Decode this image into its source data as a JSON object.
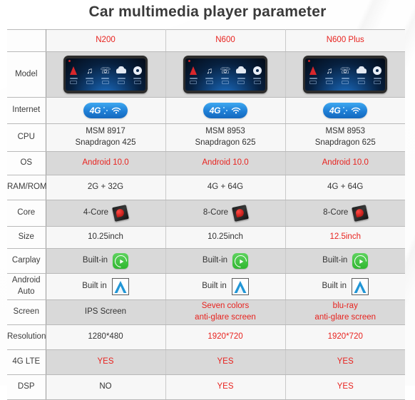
{
  "page": {
    "title": "Car multimedia player parameter",
    "accent_red": "#e8231f",
    "text_dark": "#333333",
    "row_shade": "#d9d9d9",
    "row_plain": "#f7f7f7"
  },
  "table": {
    "spec_column_header": "",
    "columns": [
      "N200",
      "N600",
      "N600 Plus"
    ],
    "rows": [
      {
        "label": "Model",
        "type": "image",
        "icon": "car-head-unit",
        "values": [
          "",
          "",
          ""
        ],
        "headunit_icons": [
          "navigation-icon",
          "music-note-icon",
          "phone-icon",
          "car-icon",
          "settings-gear-icon"
        ]
      },
      {
        "label": "Internet",
        "type": "badge",
        "icon": "4g-wifi-badge",
        "badge_text": "4G",
        "values": [
          "",
          "",
          ""
        ]
      },
      {
        "label": "CPU",
        "type": "text2",
        "values": [
          [
            "MSM 8917",
            "Snapdragon 425"
          ],
          [
            "MSM 8953",
            "Snapdragon 625"
          ],
          [
            "MSM 8953",
            "Snapdragon 625"
          ]
        ],
        "red": [
          false,
          false,
          false
        ]
      },
      {
        "label": "OS",
        "type": "text",
        "values": [
          "Android 10.0",
          "Android 10.0",
          "Android 10.0"
        ],
        "red": [
          true,
          true,
          true
        ]
      },
      {
        "label": "RAM/ROM",
        "type": "text",
        "values": [
          "2G + 32G",
          "4G + 64G",
          "4G + 64G"
        ],
        "red": [
          false,
          false,
          false
        ]
      },
      {
        "label": "Core",
        "type": "text-chip",
        "icon": "snapdragon-chip-icon",
        "values": [
          "4-Core",
          "8-Core",
          "8-Core"
        ],
        "red": [
          false,
          false,
          false
        ]
      },
      {
        "label": "Size",
        "type": "text",
        "values": [
          "10.25inch",
          "10.25inch",
          "12.5inch"
        ],
        "red": [
          false,
          false,
          true
        ]
      },
      {
        "label": "Carplay",
        "type": "text-icon",
        "icon": "carplay-icon",
        "values": [
          "Built-in",
          "Built-in",
          "Built-in"
        ],
        "red": [
          false,
          false,
          false
        ]
      },
      {
        "label": "Android Auto",
        "label_lines": [
          "Android",
          "Auto"
        ],
        "type": "text-icon",
        "icon": "android-auto-icon",
        "values": [
          "Built in",
          "Built in",
          "Built in"
        ],
        "red": [
          false,
          false,
          false
        ]
      },
      {
        "label": "Screen",
        "type": "text2",
        "values": [
          [
            "IPS Screen",
            ""
          ],
          [
            "Seven colors",
            "anti-glare screen"
          ],
          [
            "blu-ray",
            "anti-glare screen"
          ]
        ],
        "red": [
          false,
          true,
          true
        ]
      },
      {
        "label": "Resolution",
        "type": "text",
        "values": [
          "1280*480",
          "1920*720",
          "1920*720"
        ],
        "red": [
          false,
          true,
          true
        ]
      },
      {
        "label": "4G LTE",
        "type": "text",
        "values": [
          "YES",
          "YES",
          "YES"
        ],
        "red": [
          true,
          true,
          true
        ]
      },
      {
        "label": "DSP",
        "type": "text",
        "values": [
          "NO",
          "YES",
          "YES"
        ],
        "red": [
          false,
          true,
          true
        ]
      }
    ]
  }
}
